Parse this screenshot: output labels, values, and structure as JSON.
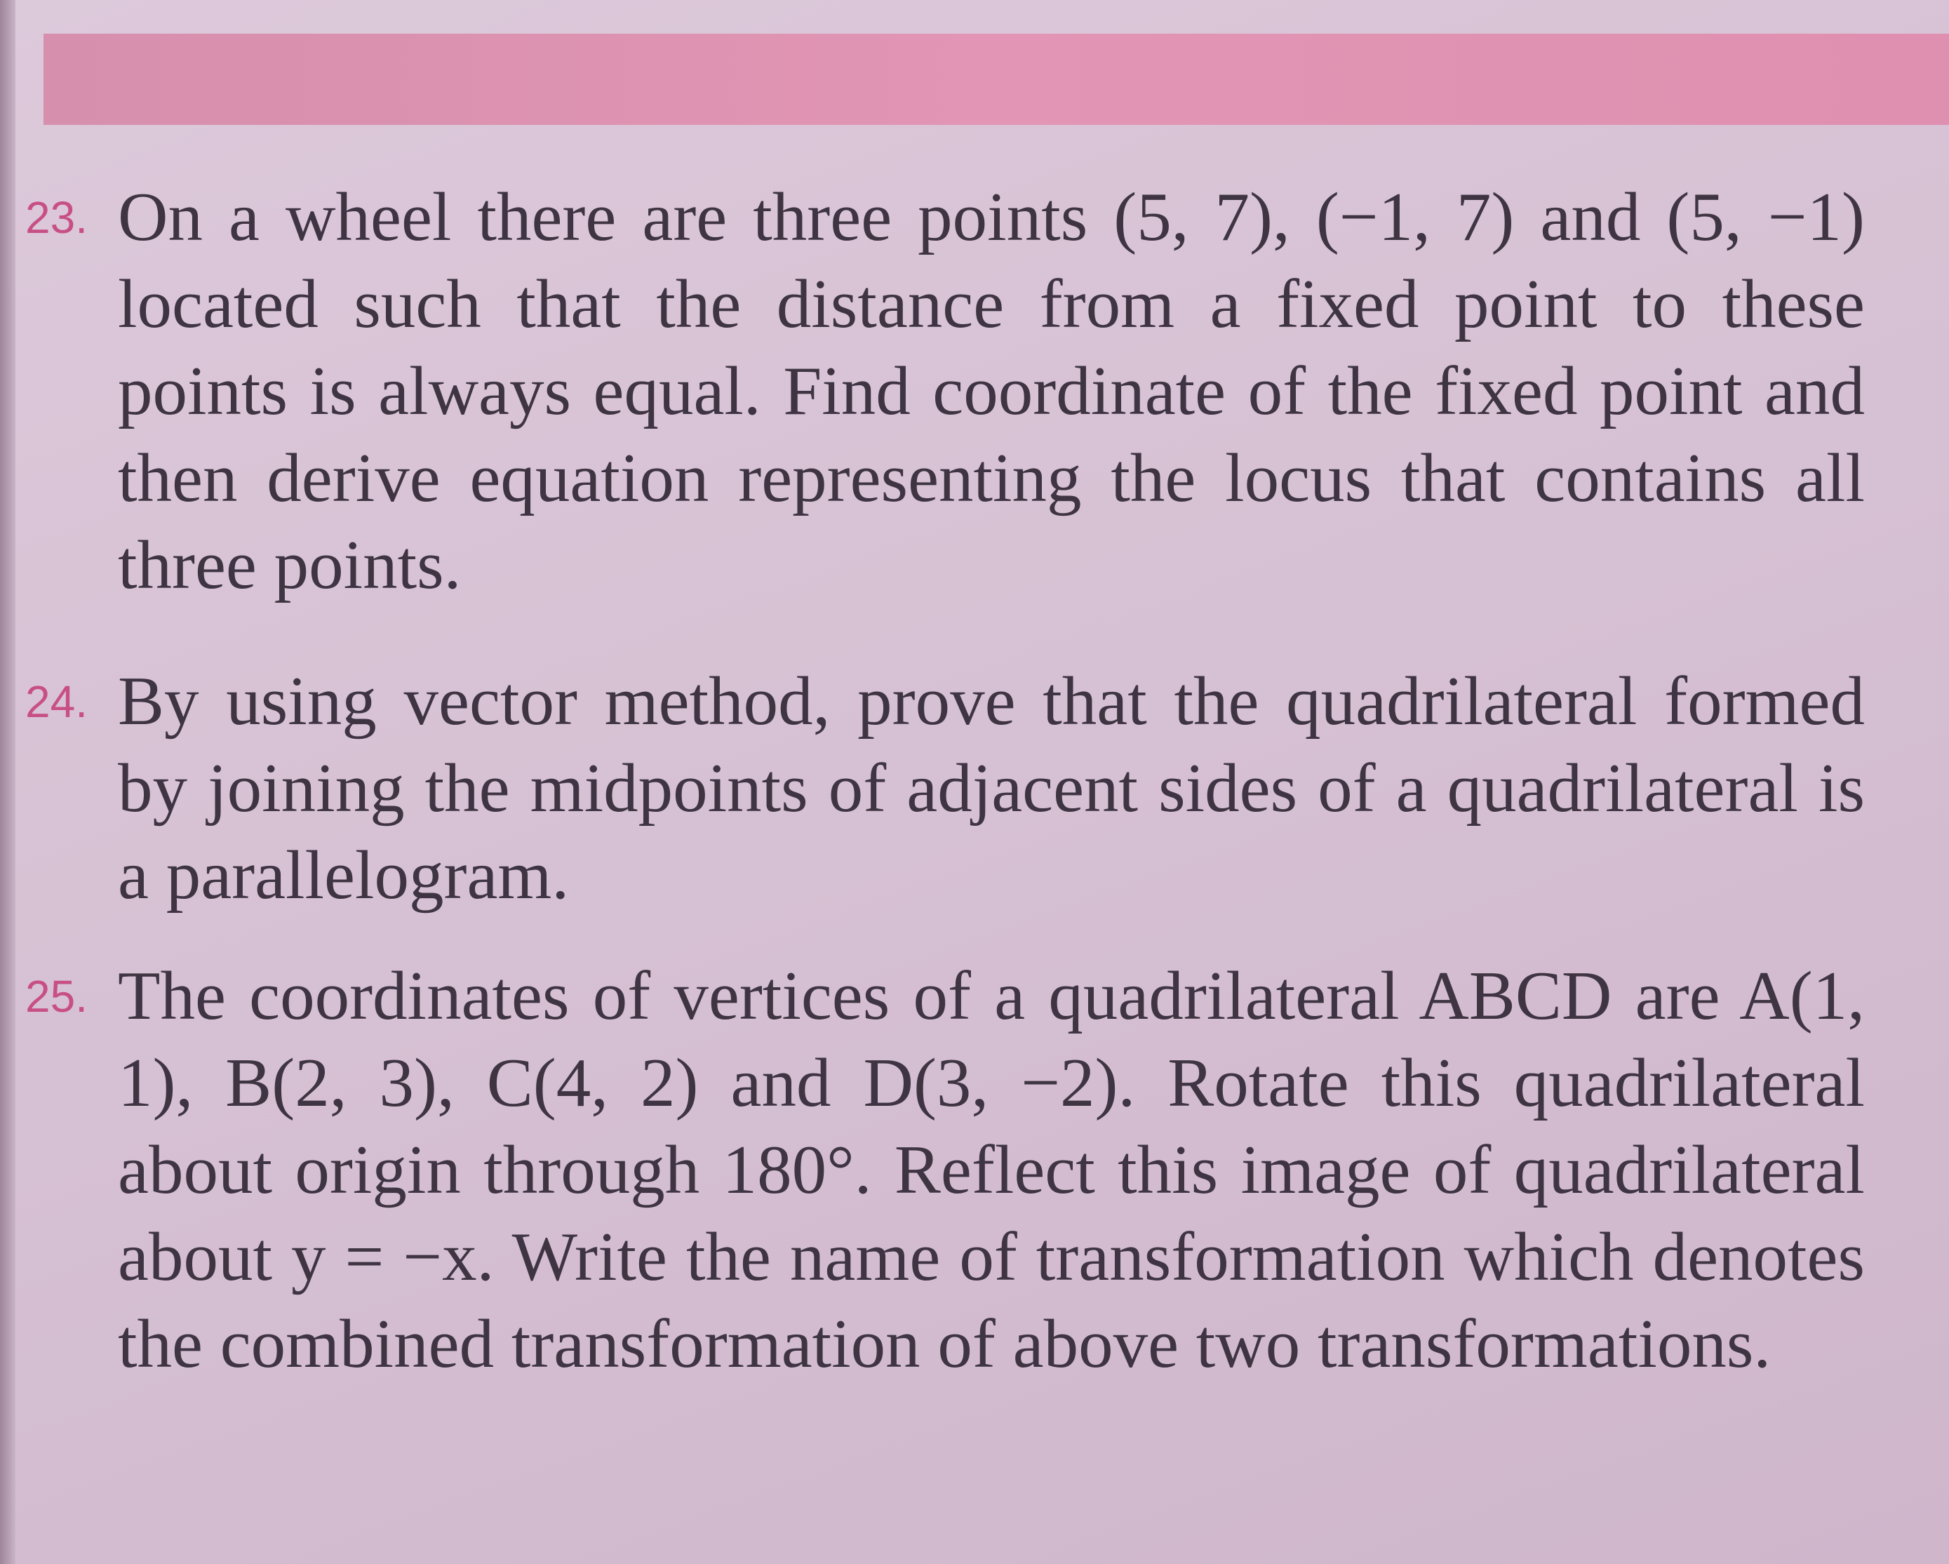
{
  "questions": [
    {
      "number": "23.",
      "text": "On a wheel there are three points (5, 7), (−1, 7) and (5, −1) located such that the distance from a fixed point to these points is always equal. Find coordinate of the fixed point and then derive equation representing the locus that contains all three points."
    },
    {
      "number": "24.",
      "text": "By using vector method, prove that the quadrilateral formed by joining the midpoints of adjacent sides of a quadrilateral is a parallelogram."
    },
    {
      "number": "25.",
      "text": "The coordinates of vertices of a quadrilateral ABCD are A(1, 1), B(2, 3), C(4, 2) and D(3, −2). Rotate this quadrilateral about origin through 180°. Reflect this image of quadrilateral about y = −x. Write the name of transformation which denotes the combined transformation of above two transformations."
    }
  ],
  "colors": {
    "page_background": "#d6c0d3",
    "header_band": "#e295b4",
    "question_number": "#c84f86",
    "body_text": "#3f3542"
  }
}
